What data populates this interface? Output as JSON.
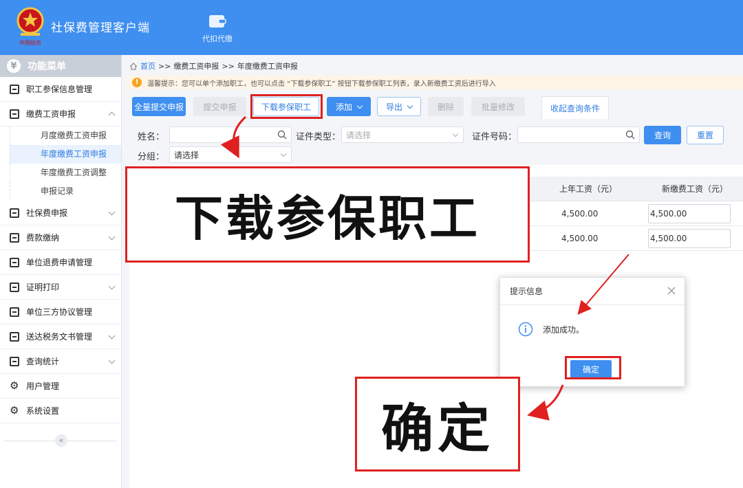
{
  "header": {
    "app_title": "社保费管理客户端",
    "tool_label": "代扣代缴",
    "accent": "#3f8ff0"
  },
  "sidebar": {
    "title": "功能菜单",
    "items": [
      {
        "label": "职工参保信息管理",
        "icon": "grid-icon"
      },
      {
        "label": "缴费工资申报",
        "icon": "edit-icon",
        "expanded": true
      },
      {
        "label": "社保费申报",
        "icon": "doc-icon"
      },
      {
        "label": "费款缴纳",
        "icon": "book-icon"
      },
      {
        "label": "单位退费申请管理",
        "icon": "grid-icon"
      },
      {
        "label": "证明打印",
        "icon": "print-icon"
      },
      {
        "label": "单位三方协议管理",
        "icon": "book-icon"
      },
      {
        "label": "送达税务文书管理",
        "icon": "stamp-icon"
      },
      {
        "label": "查询统计",
        "icon": "chart-icon"
      },
      {
        "label": "用户管理",
        "icon": "gear-icon"
      },
      {
        "label": "系统设置",
        "icon": "gear-icon"
      }
    ],
    "sub_items": [
      "月度缴费工资申报",
      "年度缴费工资申报",
      "年度缴费工资调整",
      "申报记录"
    ],
    "collapse": "«"
  },
  "breadcrumb": {
    "home": "首页",
    "sep": ">>",
    "level1": "缴费工资申报",
    "level2": "年度缴费工资申报"
  },
  "tip": {
    "text": "温馨提示：您可以单个添加职工，也可以点击 “下载参保职工” 按钮下载参保职工列表，录入新缴费工资后进行导入"
  },
  "toolbar": {
    "submit_all": "全量提交申报",
    "submit": "提交申报",
    "download": "下载参保职工",
    "add": "添加",
    "export": "导出",
    "delete": "删除",
    "batch_edit": "批量修改",
    "collapse_query": "收起查询条件"
  },
  "form": {
    "name_label": "姓名：",
    "id_type_label": "证件类型：",
    "id_type_placeholder": "请选择",
    "id_no_label": "证件号码：",
    "group_label": "分组：",
    "group_value": "请选择",
    "query": "查询",
    "reset": "重置"
  },
  "table": {
    "columns": [
      "上年工资（元）",
      "新缴费工资（元）"
    ],
    "rows": [
      {
        "last_year": "4,500.00",
        "new_wage": "4,500.00"
      },
      {
        "last_year": "4,500.00",
        "new_wage": "4,500.00"
      }
    ]
  },
  "dialog": {
    "title": "提示信息",
    "message": "添加成功。",
    "ok": "确定"
  },
  "annotations": {
    "download_caption": "下载参保职工",
    "confirm_caption": "确定",
    "highlight_color": "#e02020"
  }
}
